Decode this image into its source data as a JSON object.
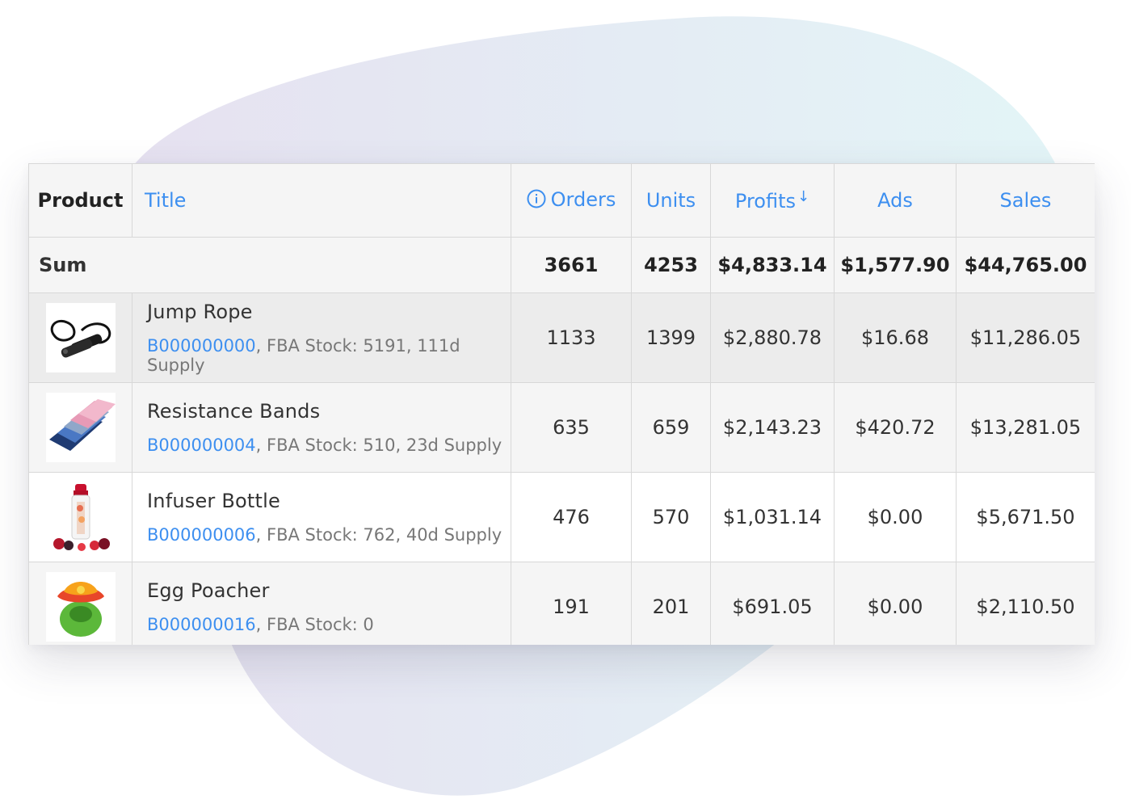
{
  "header": {
    "product": "Product",
    "title": "Title",
    "orders": "Orders",
    "units": "Units",
    "profits": "Profits",
    "profits_sort_arrow": "↓",
    "ads": "Ads",
    "sales": "Sales"
  },
  "sum": {
    "label": "Sum",
    "orders": "3661",
    "units": "4253",
    "profits": "$4,833.14",
    "ads": "$1,577.90",
    "sales": "$44,765.00"
  },
  "rows": [
    {
      "title": "Jump Rope",
      "asin": "B000000000",
      "stock": ", FBA Stock: 5191, 111d Supply",
      "orders": "1133",
      "units": "1399",
      "profits": "$2,880.78",
      "ads": "$16.68",
      "sales": "$11,286.05"
    },
    {
      "title": "Resistance Bands",
      "asin": "B000000004",
      "stock": ", FBA Stock: 510, 23d Supply",
      "orders": "635",
      "units": "659",
      "profits": "$2,143.23",
      "ads": "$420.72",
      "sales": "$13,281.05"
    },
    {
      "title": "Infuser Bottle",
      "asin": "B000000006",
      "stock": ", FBA Stock: 762, 40d Supply",
      "orders": "476",
      "units": "570",
      "profits": "$1,031.14",
      "ads": "$0.00",
      "sales": "$5,671.50"
    },
    {
      "title": "Egg Poacher",
      "asin": "B000000016",
      "stock": ", FBA Stock: 0",
      "orders": "191",
      "units": "201",
      "profits": "$691.05",
      "ads": "$0.00",
      "sales": "$2,110.50"
    }
  ],
  "colors": {
    "link_blue": "#3d8ff0",
    "profit_blue": "#2424e8",
    "ads_red": "#ee2a2a"
  },
  "icons": {
    "orders_info": "info-circle-icon",
    "sort": "sort-desc-arrow-icon"
  }
}
